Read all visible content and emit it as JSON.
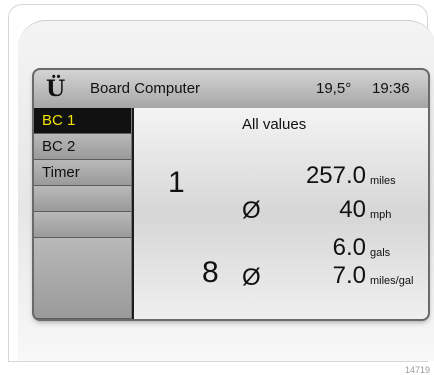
{
  "topbar": {
    "logo": "Ü",
    "title": "Board Computer",
    "temperature": "19,5°",
    "time": "19:36"
  },
  "menu": {
    "items": [
      {
        "label": "BC 1"
      },
      {
        "label": "BC 2"
      },
      {
        "label": "Timer"
      },
      {
        "label": ""
      },
      {
        "label": ""
      },
      {
        "label": ""
      }
    ]
  },
  "content": {
    "header": "All values",
    "group1": {
      "index": "1",
      "distance_value": "257.0",
      "distance_unit": "miles",
      "avg_symbol": "Ø",
      "speed_value": "40",
      "speed_unit": "mph"
    },
    "group2": {
      "index": "8",
      "fuel_value": "6.0",
      "fuel_unit": "gals",
      "avg_symbol": "Ø",
      "consumption_value": "7.0",
      "consumption_unit": "miles/gal"
    }
  },
  "footer": {
    "code": "14719"
  },
  "colors": {
    "active_text": "#f2e400",
    "active_bg": "#111111"
  }
}
